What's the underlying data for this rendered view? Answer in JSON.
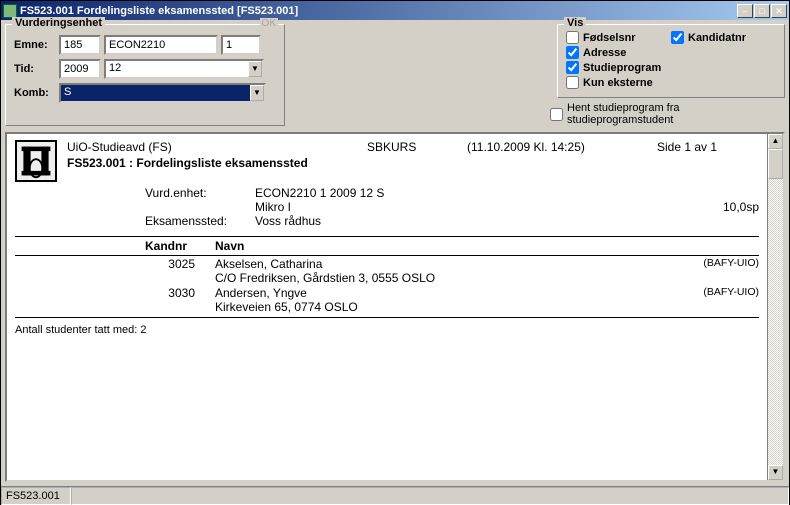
{
  "title": "FS523.001 Fordelingsliste eksamenssted [FS523.001]",
  "vurd": {
    "legend": "Vurderingsenhet",
    "ok": "OK",
    "emne_label": "Emne:",
    "emne_1": "185",
    "emne_2": "ECON2210",
    "emne_3": "1",
    "tid_label": "Tid:",
    "tid_1": "2009",
    "tid_2": "12",
    "komb_label": "Komb:",
    "komb_val": "S"
  },
  "vis": {
    "legend": "Vis",
    "fodselsnr": "Fødselsnr",
    "kandidatnr": "Kandidatnr",
    "adresse": "Adresse",
    "studieprogram": "Studieprogram",
    "kun_eksterne": "Kun eksterne"
  },
  "hent": "Hent studieprogram fra studieprogramstudent",
  "report": {
    "org": "UiO-Studieavd (FS)",
    "sys": "SBKURS",
    "datetime": "(11.10.2009 Kl. 14:25)",
    "page": "Side 1 av 1",
    "title": "FS523.001 : Fordelingsliste eksamenssted",
    "meta": {
      "vurdenhet_lbl": "Vurd.enhet:",
      "vurdenhet_val": "ECON2210 1 2009 12 S",
      "course": "Mikro I",
      "score": "10,0sp",
      "sted_lbl": "Eksamenssted:",
      "sted_val": "Voss rådhus"
    },
    "headers": {
      "kandnr": "Kandnr",
      "navn": "Navn"
    },
    "rows": [
      {
        "kandnr": "3025",
        "navn": "Akselsen, Catharina",
        "prog": "(BAFY-UIO)",
        "addr": "C/O Fredriksen, Gårdstien 3, 0555 OSLO"
      },
      {
        "kandnr": "3030",
        "navn": "Andersen, Yngve",
        "prog": "(BAFY-UIO)",
        "addr": "Kirkeveien 65, 0774 OSLO"
      }
    ],
    "summary": "Antall studenter tatt med: 2"
  },
  "status": "FS523.001"
}
